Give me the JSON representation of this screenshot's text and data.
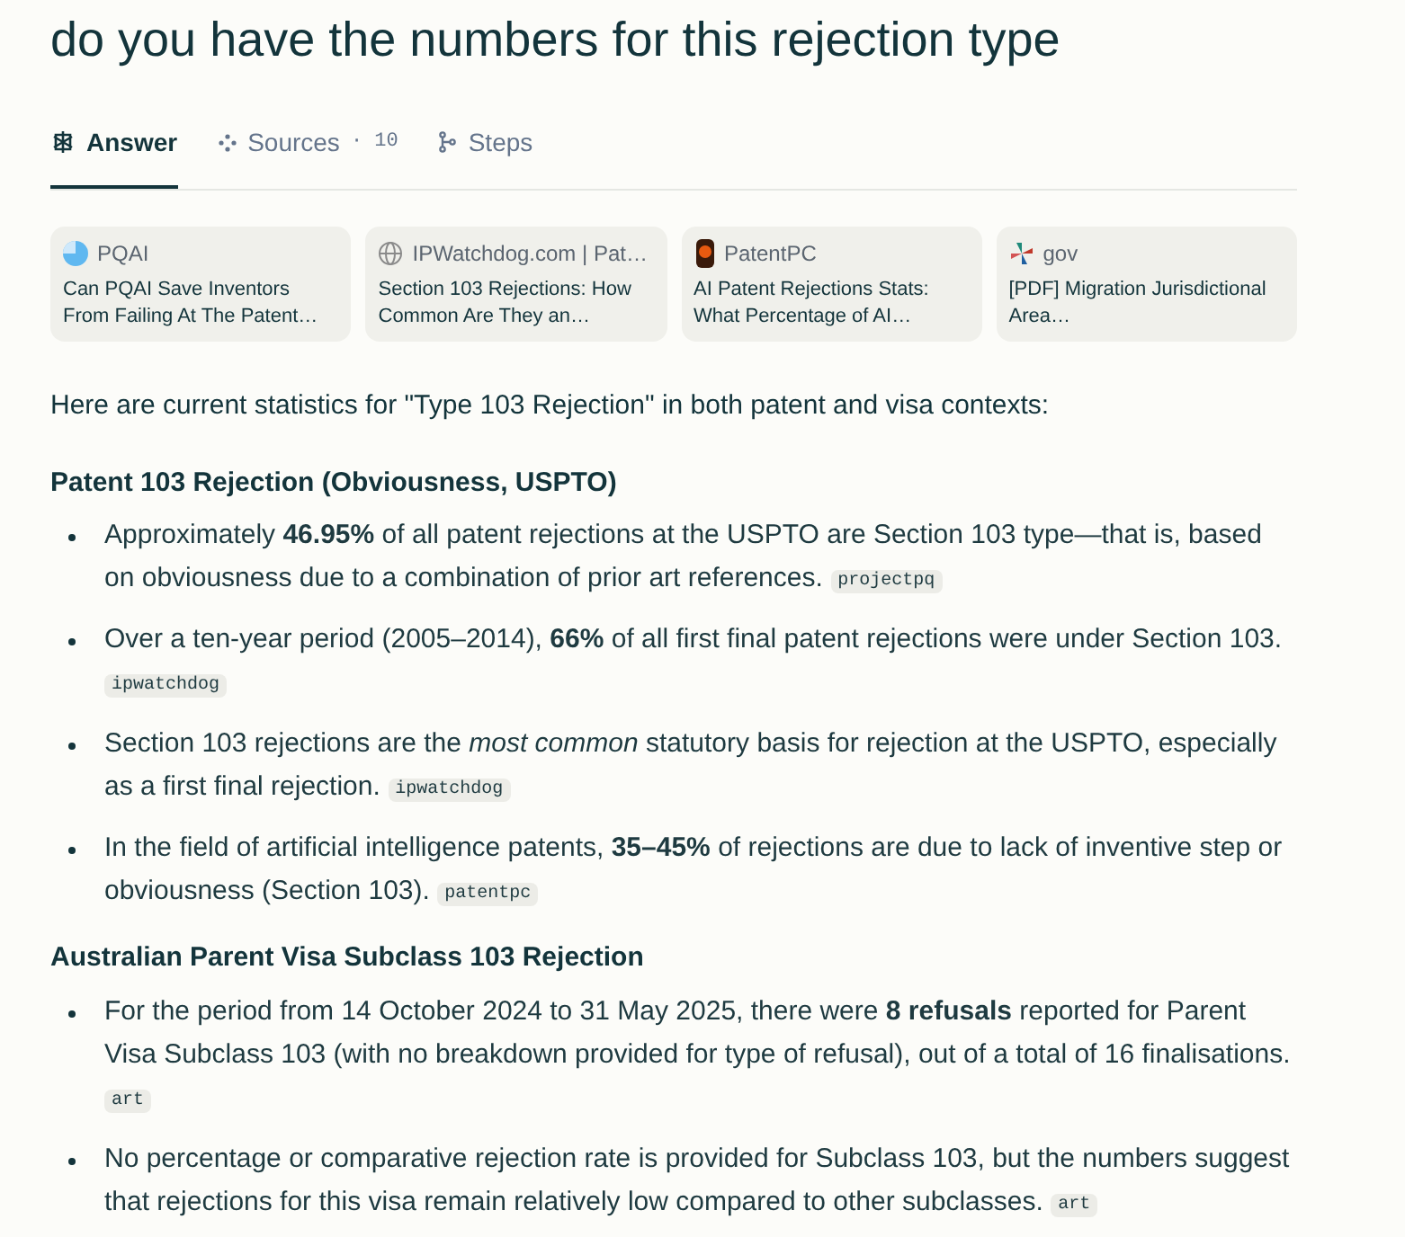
{
  "title": "do you have the numbers for this rejection type",
  "tabs": [
    {
      "label": "Answer",
      "selected": true,
      "kind": "logo"
    },
    {
      "label": "Sources",
      "count": "· 10",
      "selected": false,
      "kind": "dots"
    },
    {
      "label": "Steps",
      "selected": false,
      "kind": "branch"
    }
  ],
  "sources": [
    {
      "site": "PQAI",
      "title": "Can PQAI Save Inventors From Failing At The Patent…",
      "kind": "quarter"
    },
    {
      "site": "IPWatchdog.com | Pat…",
      "title": "Section 103 Rejections: How Common Are They an…",
      "kind": "globe"
    },
    {
      "site": "PatentPC",
      "title": "AI Patent Rejections Stats: What Percentage of AI…",
      "kind": "lamp"
    },
    {
      "site": "gov",
      "title": "[PDF] Migration Jurisdictional Area…",
      "kind": "pinwheel"
    }
  ],
  "intro": "Here are current statistics for \"Type 103 Rejection\" in both patent and visa contexts:",
  "sections": [
    {
      "heading": "Patent 103 Rejection (Obviousness, USPTO)",
      "items": [
        {
          "text": "Approximately **46.95%** of all patent rejections at the USPTO are Section 103 type—that is, based on obviousness due to a combination of prior art references.",
          "citation": "projectpq"
        },
        {
          "text": "Over a ten-year period (2005–2014), **66%** of all first final patent rejections were under Section 103.",
          "citation": "ipwatchdog"
        },
        {
          "text": "Section 103 rejections are the *most common* statutory basis for rejection at the USPTO, especially as a first final rejection.",
          "citation": "ipwatchdog"
        },
        {
          "text": "In the field of artificial intelligence patents, **35–45%** of rejections are due to lack of inventive step or obviousness (Section 103).",
          "citation": "patentpc"
        }
      ]
    },
    {
      "heading": "Australian Parent Visa Subclass 103 Rejection",
      "items": [
        {
          "text": "For the period from 14 October 2024 to 31 May 2025, there were **8 refusals** reported for Parent Visa Subclass 103 (with no breakdown provided for type of refusal), out of a total of 16 finalisations.",
          "citation": "art"
        },
        {
          "text": "No percentage or comparative rejection rate is provided for Subclass 103, but the numbers suggest that rejections for this visa remain relatively low compared to other subclasses.",
          "citation": "art"
        }
      ]
    }
  ]
}
